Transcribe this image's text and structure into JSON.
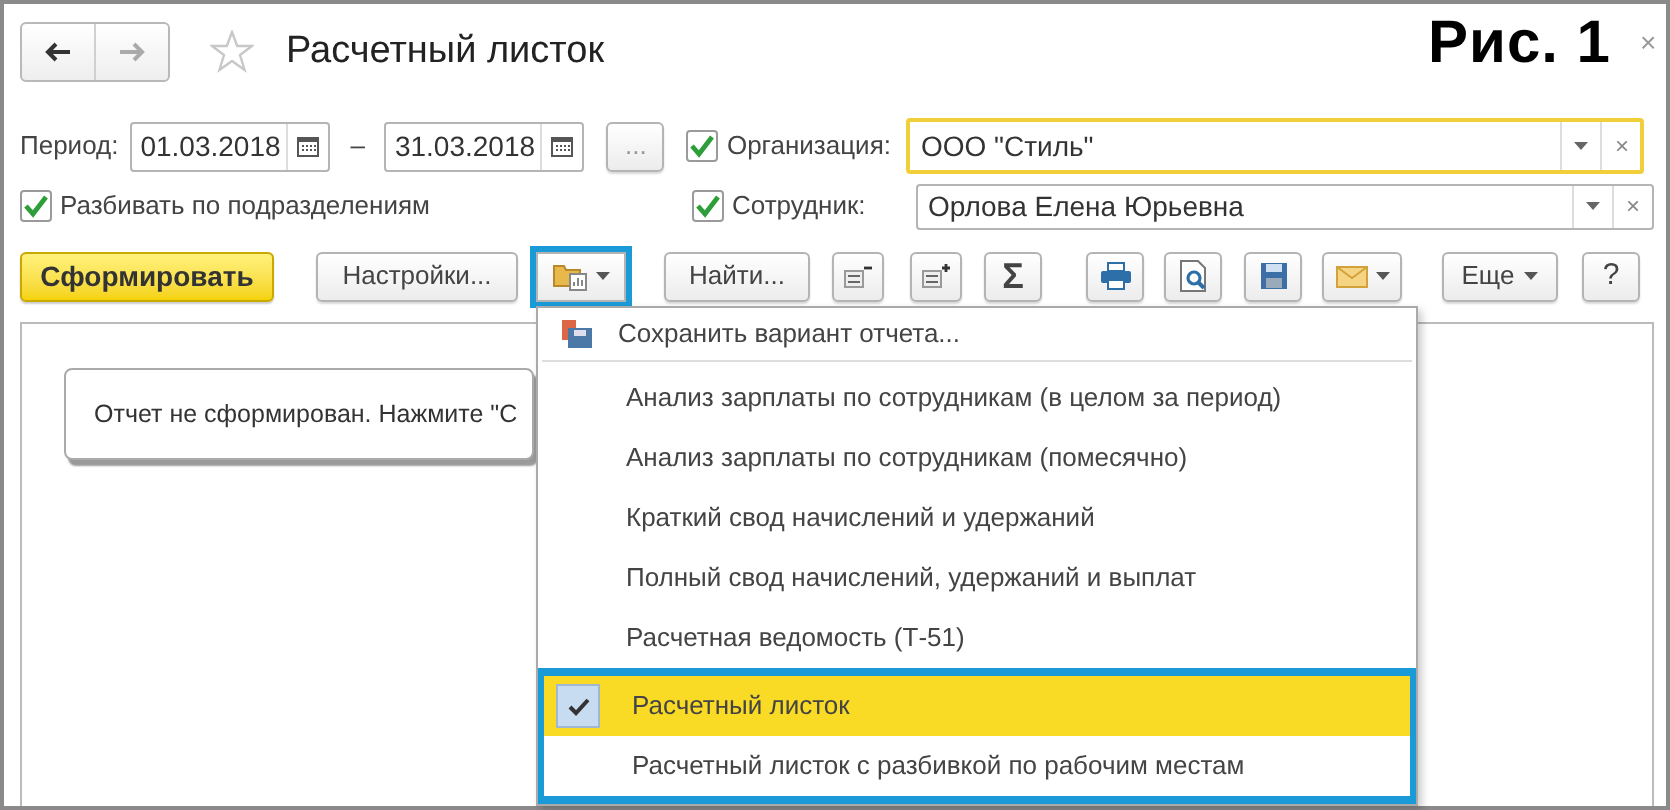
{
  "window": {
    "title": "Расчетный листок",
    "close": "×"
  },
  "figure_label": "Рис. 1",
  "filters": {
    "period_label": "Период:",
    "date_from": "01.03.2018",
    "dash": "–",
    "date_to": "31.03.2018",
    "more_button": "...",
    "organization": {
      "checked": true,
      "label": "Организация:",
      "value": "ООО \"Стиль\"",
      "clear": "×"
    },
    "split": {
      "checked": true,
      "label": "Разбивать по подразделениям"
    },
    "employee": {
      "checked": true,
      "label": "Сотрудник:",
      "value": "Орлова Елена Юрьевна",
      "clear": "×"
    }
  },
  "toolbar": {
    "generate": "Сформировать",
    "settings": "Настройки...",
    "variant_button": {
      "framed": true
    },
    "find": "Найти...",
    "sigma": "Σ",
    "more": "Еще",
    "help": "?"
  },
  "report": {
    "message": "Отчет не сформирован. Нажмите \"С"
  },
  "menu": {
    "save_variant": "Сохранить вариант отчета...",
    "items": [
      {
        "label": "Анализ зарплаты по сотрудникам (в целом за период)",
        "selected": false,
        "framed": false
      },
      {
        "label": "Анализ зарплаты по сотрудникам (помесячно)",
        "selected": false,
        "framed": false
      },
      {
        "label": "Краткий свод начислений и удержаний",
        "selected": false,
        "framed": false
      },
      {
        "label": "Полный свод начислений, удержаний и выплат",
        "selected": false,
        "framed": false
      },
      {
        "label": "Расчетная ведомость (Т-51)",
        "selected": false,
        "framed": false
      },
      {
        "label": "Расчетный листок",
        "selected": true,
        "framed": true
      },
      {
        "label": "Расчетный листок с разбивкой по рабочим местам",
        "selected": false,
        "framed": true
      }
    ]
  }
}
